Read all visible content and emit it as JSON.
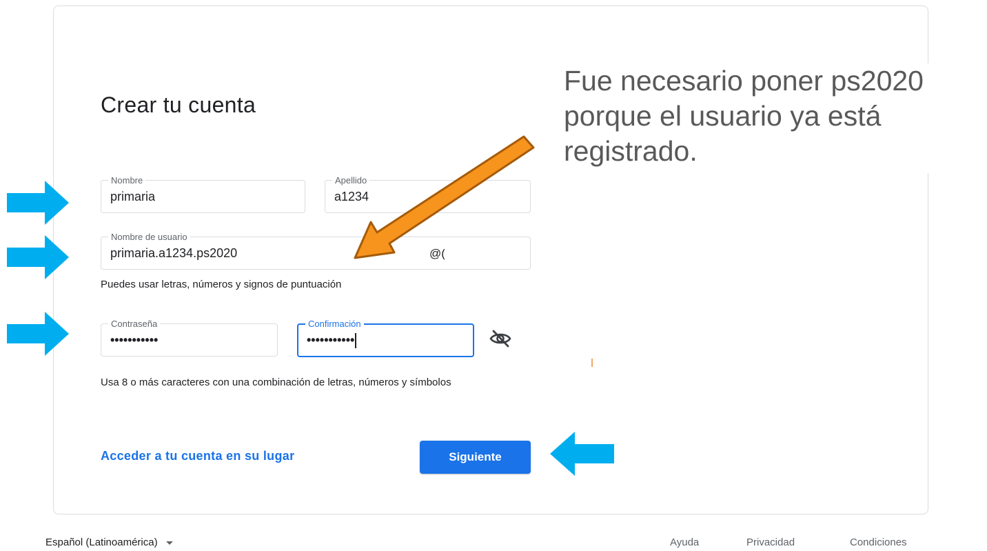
{
  "form": {
    "title": "Crear tu cuenta",
    "first_name": {
      "label": "Nombre",
      "value": "primaria"
    },
    "last_name": {
      "label": "Apellido",
      "value": "a1234"
    },
    "username": {
      "label": "Nombre de usuario",
      "value": "primaria.a1234.ps2020",
      "suffix": "@("
    },
    "username_helper": "Puedes usar letras, números y signos de puntuación",
    "password": {
      "label": "Contraseña",
      "value": "•••••••••••"
    },
    "confirm": {
      "label": "Confirmación",
      "value": "•••••••••••"
    },
    "password_helper": "Usa 8 o más caracteres con una combinación de letras, números y símbolos",
    "signin_link": "Acceder a tu cuenta en su lugar",
    "next_button": "Siguiente",
    "toggle_visibility_icon": "eye-off-icon"
  },
  "annotation": {
    "note": "Fue necesario poner ps2020 porque el usuario ya está registrado.",
    "arrow_colors": {
      "blue": "#00aeef",
      "orange": "#f7941d"
    }
  },
  "footer": {
    "language": "Español (Latinoamérica)",
    "links": [
      "Ayuda",
      "Privacidad",
      "Condiciones"
    ]
  },
  "colors": {
    "accent": "#1a73e8",
    "border": "#dadce0",
    "text": "#202124",
    "muted": "#5f6368"
  }
}
